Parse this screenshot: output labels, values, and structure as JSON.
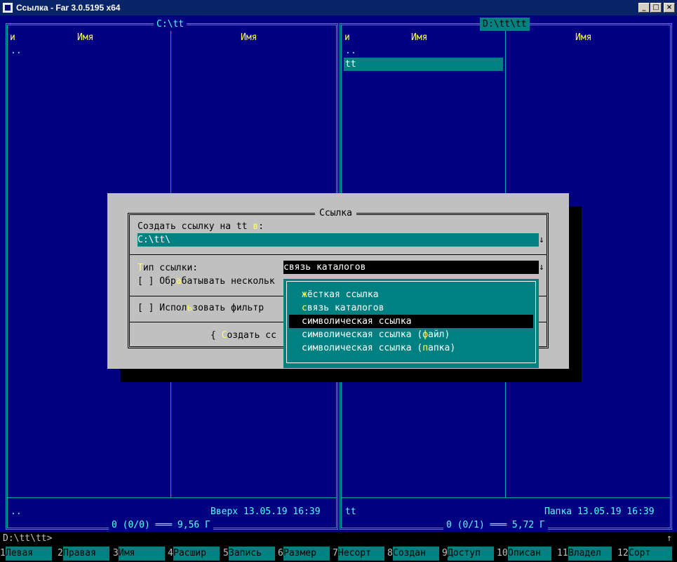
{
  "window": {
    "title": "Ссылка - Far 3.0.5195 x64",
    "buttons": {
      "minimize": "_",
      "maximize": "□",
      "close": "×"
    }
  },
  "left_panel": {
    "path": "C:\\tt",
    "col_sort": "и",
    "col_name_1": "Имя",
    "col_name_2": "Имя",
    "items": [
      ".."
    ],
    "status_name": "..",
    "status_info": "Вверх 13.05.19 16:39",
    "summary": "0 (0/0) ═══ 9,56 Г"
  },
  "right_panel": {
    "path": "D:\\tt\\tt",
    "col_sort": "и",
    "col_name_1": "Имя",
    "col_name_2": "Имя",
    "items": [
      "..",
      "tt"
    ],
    "selected_item": "tt",
    "status_name": "tt",
    "status_info": "Папка 13.05.19 16:39",
    "summary": "0 (0/1) ═══ 5,72 Г"
  },
  "dialog": {
    "title": "Ссылка",
    "target_label_pre": "Создать ссылку на tt ",
    "target_label_hot": "в",
    "target_label_post": ":",
    "target_value": "C:\\tt\\",
    "arrow": "↓",
    "type_label_hot": "Т",
    "type_label_rest": "ип ссылки:",
    "type_value": "связь каталогов",
    "multi_pre": "[ ] Обр",
    "multi_hot": "а",
    "multi_post": "батывать нескольк",
    "filter_pre": "[ ] Испол",
    "filter_hot": "ь",
    "filter_post": "зовать фильтр",
    "create_pre": "{ ",
    "create_hot": "С",
    "create_post": "оздать сс"
  },
  "dropdown": {
    "items": [
      {
        "hot": "ж",
        "rest": "ёсткая ссылка"
      },
      {
        "hot": "с",
        "rest": "вязь каталогов"
      },
      {
        "hot": "",
        "rest": "символическая ссылка"
      },
      {
        "pre": "символическая ссылка (",
        "hot": "ф",
        "rest": "айл)"
      },
      {
        "pre": "символическая ссылка (",
        "hot": "п",
        "rest": "апка)"
      }
    ],
    "selected_index": 2
  },
  "command_line": {
    "prompt": "D:\\tt\\tt>",
    "scroll_arrow": "↑"
  },
  "keybar": [
    {
      "num": "1",
      "label": "Левая"
    },
    {
      "num": "2",
      "label": "Правая"
    },
    {
      "num": "3",
      "label": "Имя"
    },
    {
      "num": "4",
      "label": "Расшир"
    },
    {
      "num": "5",
      "label": "Запись"
    },
    {
      "num": "6",
      "label": "Размер"
    },
    {
      "num": "7",
      "label": "Несорт"
    },
    {
      "num": "8",
      "label": "Создан"
    },
    {
      "num": "9",
      "label": "Доступ"
    },
    {
      "num": "10",
      "label": "Описан"
    },
    {
      "num": "11",
      "label": "Владел"
    },
    {
      "num": "12",
      "label": "Сорт"
    }
  ],
  "colors": {
    "panel_bg": "#000080",
    "frame": "#00aaaa",
    "dialog_bg": "#c0c0c0",
    "highlight": "#008080",
    "hotkey": "#ffff55"
  }
}
